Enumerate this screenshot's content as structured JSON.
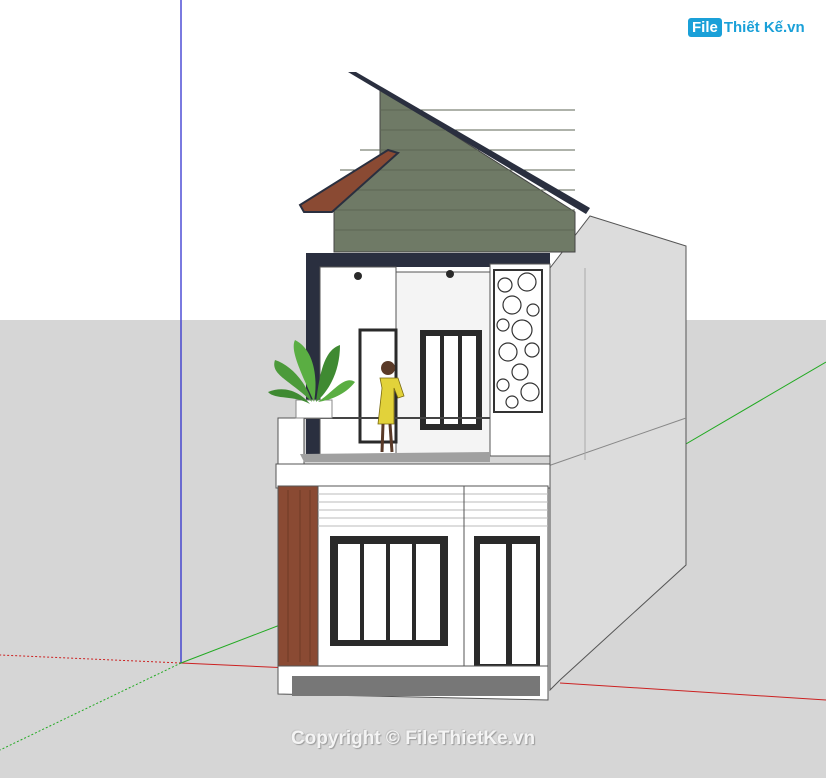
{
  "watermark": {
    "logo_file": "File",
    "logo_rest": "Thiết Kế.vn",
    "copyright": "Copyright © FileThietKe.vn"
  },
  "colors": {
    "ground": "#d6d6d6",
    "sky": "#ffffff",
    "axis_blue": "#2222cc",
    "axis_red": "#cc2222",
    "axis_green": "#22aa22",
    "wall_white": "#ffffff",
    "wall_side": "#dcdcdc",
    "roof_slats": "#6f7a66",
    "roof_trim": "#2a2f3f",
    "wood_accent": "#8a4a33",
    "window_frame": "#2a2a2a",
    "glass": "#ffffff",
    "plant_green": "#4c9a3a",
    "figure_dress": "#e2d23a",
    "logo_blue": "#1aa0d8"
  }
}
